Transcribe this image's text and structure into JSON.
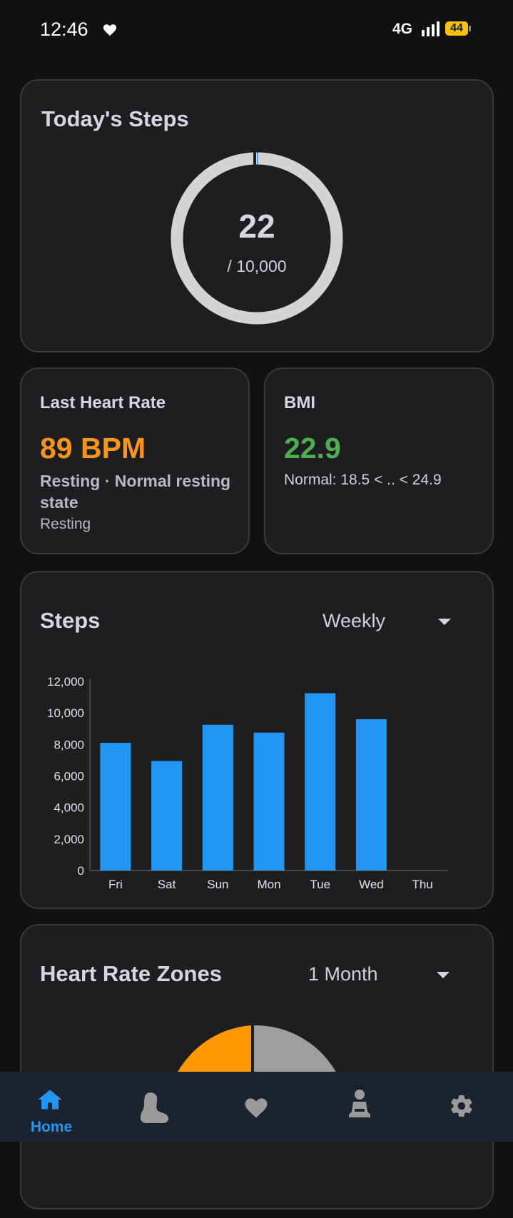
{
  "status_bar": {
    "time": "12:46",
    "network": "4G",
    "battery": "44"
  },
  "todays_steps": {
    "title": "Today's Steps",
    "count": "22",
    "goal": "/ 10,000",
    "progress": 0.0022
  },
  "heart_rate": {
    "title": "Last Heart Rate",
    "value": "89 BPM",
    "description": "Resting · Normal resting state",
    "state": "Resting",
    "color": "#f7941d"
  },
  "bmi": {
    "title": "BMI",
    "value": "22.9",
    "range": "Normal: 18.5 < .. < 24.9",
    "color": "#4caf50"
  },
  "steps_chart": {
    "title": "Steps",
    "period": "Weekly",
    "chart_data": {
      "type": "bar",
      "categories": [
        "Fri",
        "Sat",
        "Sun",
        "Mon",
        "Tue",
        "Wed",
        "Thu"
      ],
      "values": [
        8100,
        6950,
        9250,
        8750,
        11250,
        9600,
        0
      ],
      "ylim": [
        0,
        12000
      ],
      "yticks": [
        0,
        2000,
        4000,
        6000,
        8000,
        10000,
        12000
      ],
      "ytick_labels": [
        "0",
        "2,000",
        "4,000",
        "6,000",
        "8,000",
        "10,000",
        "12,000"
      ],
      "bar_color": "#2196f3",
      "grid": false
    }
  },
  "heart_zones": {
    "title": "Heart Rate Zones",
    "period": "1 Month",
    "colors": {
      "zone_a": "#ff9800",
      "zone_b": "#9e9e9e"
    }
  },
  "bottom_nav": {
    "items": [
      {
        "id": "home",
        "label": "Home",
        "icon": "home-icon",
        "active": true
      },
      {
        "id": "steps",
        "label": "",
        "icon": "foot-icon",
        "active": false
      },
      {
        "id": "heart",
        "label": "",
        "icon": "heart-icon",
        "active": false
      },
      {
        "id": "profile",
        "label": "",
        "icon": "meditation-icon",
        "active": false
      },
      {
        "id": "settings",
        "label": "",
        "icon": "gear-icon",
        "active": false
      }
    ]
  },
  "colors": {
    "accent": "#2196f3",
    "background": "#111111",
    "card": "#1e1e20",
    "nav": "#1b2230"
  }
}
